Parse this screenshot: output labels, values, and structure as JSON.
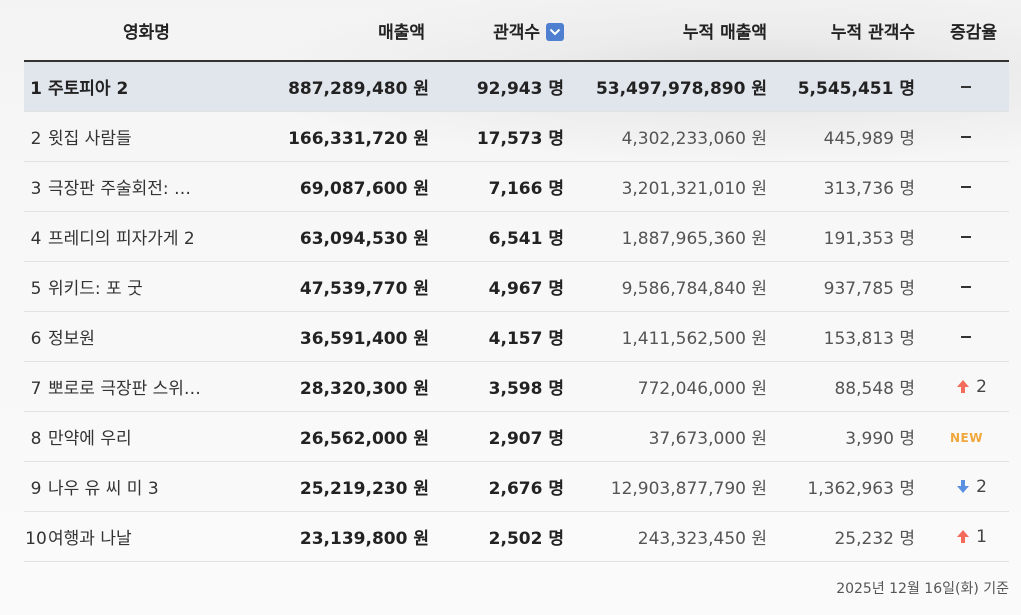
{
  "headers": {
    "title": "영화명",
    "sales": "매출액",
    "audience": "관객수",
    "acc_sales": "누적 매출액",
    "acc_audience": "누적 관객수",
    "change": "증감율"
  },
  "rows": [
    {
      "rank": "1",
      "title": "주토피아 2",
      "sales": "887,289,480 원",
      "audience": "92,943 명",
      "acc_sales": "53,497,978,890 원",
      "acc_audience": "5,545,451 명",
      "change_type": "none",
      "change": ""
    },
    {
      "rank": "2",
      "title": "윗집 사람들",
      "sales": "166,331,720 원",
      "audience": "17,573 명",
      "acc_sales": "4,302,233,060 원",
      "acc_audience": "445,989 명",
      "change_type": "none",
      "change": ""
    },
    {
      "rank": "3",
      "title": "극장판 주술회전: …",
      "sales": "69,087,600 원",
      "audience": "7,166 명",
      "acc_sales": "3,201,321,010 원",
      "acc_audience": "313,736 명",
      "change_type": "none",
      "change": ""
    },
    {
      "rank": "4",
      "title": "프레디의 피자가게 2",
      "sales": "63,094,530 원",
      "audience": "6,541 명",
      "acc_sales": "1,887,965,360 원",
      "acc_audience": "191,353 명",
      "change_type": "none",
      "change": ""
    },
    {
      "rank": "5",
      "title": "위키드: 포 굿",
      "sales": "47,539,770 원",
      "audience": "4,967 명",
      "acc_sales": "9,586,784,840 원",
      "acc_audience": "937,785 명",
      "change_type": "none",
      "change": ""
    },
    {
      "rank": "6",
      "title": "정보원",
      "sales": "36,591,400 원",
      "audience": "4,157 명",
      "acc_sales": "1,411,562,500 원",
      "acc_audience": "153,813 명",
      "change_type": "none",
      "change": ""
    },
    {
      "rank": "7",
      "title": "뽀로로 극장판 스위…",
      "sales": "28,320,300 원",
      "audience": "3,598 명",
      "acc_sales": "772,046,000 원",
      "acc_audience": "88,548 명",
      "change_type": "up",
      "change": "2"
    },
    {
      "rank": "8",
      "title": "만약에 우리",
      "sales": "26,562,000 원",
      "audience": "2,907 명",
      "acc_sales": "37,673,000 원",
      "acc_audience": "3,990 명",
      "change_type": "new",
      "change": "NEW"
    },
    {
      "rank": "9",
      "title": "나우 유 씨 미 3",
      "sales": "25,219,230 원",
      "audience": "2,676 명",
      "acc_sales": "12,903,877,790 원",
      "acc_audience": "1,362,963 명",
      "change_type": "down",
      "change": "2"
    },
    {
      "rank": "10",
      "title": "여행과 나날",
      "sales": "23,139,800 원",
      "audience": "2,502 명",
      "acc_sales": "243,323,450 원",
      "acc_audience": "25,232 명",
      "change_type": "up",
      "change": "1"
    }
  ],
  "footer": "2025년 12월 16일(화) 기준",
  "colors": {
    "up": "#f26b5b",
    "down": "#5b8fe0",
    "new": "#f0a73c",
    "sort_button": "#4f7fd0",
    "top_row": "#e1e5ec"
  }
}
